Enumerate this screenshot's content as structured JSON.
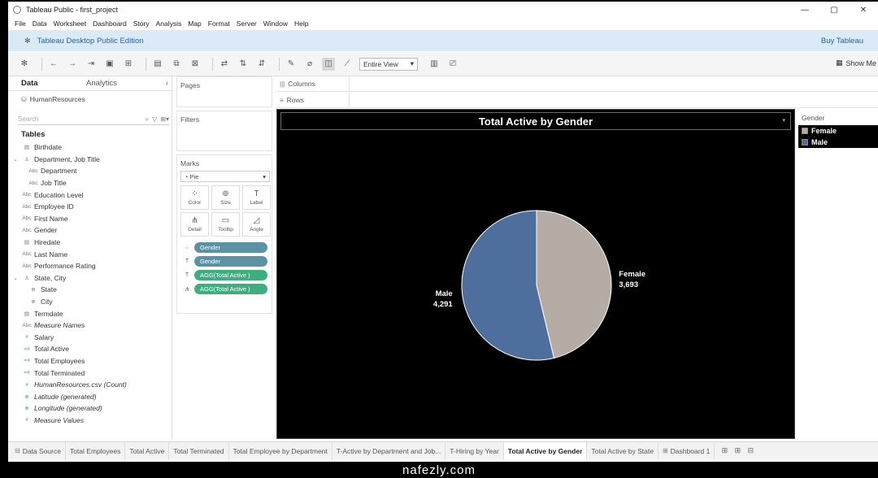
{
  "window": {
    "title": "Tableau Public - first_project",
    "controls": [
      "—",
      "▢",
      "✕"
    ]
  },
  "menu": [
    "File",
    "Data",
    "Worksheet",
    "Dashboard",
    "Story",
    "Analysis",
    "Map",
    "Format",
    "Server",
    "Window",
    "Help"
  ],
  "banner": {
    "edition": "Tableau Desktop Public Edition",
    "buy": "Buy Tableau"
  },
  "toolbar": {
    "view_mode": "Entire View",
    "show_me": "Show Me"
  },
  "data_pane": {
    "tabs": [
      "Data",
      "Analytics"
    ],
    "datasource": "HumanResources",
    "search_placeholder": "Search",
    "tables_heading": "Tables",
    "fields": [
      {
        "name": "Birthdate",
        "icon": "▤",
        "level": 0
      },
      {
        "name": "Department, Job Title",
        "icon": "♙",
        "level": 0,
        "expander": "⌄"
      },
      {
        "name": "Department",
        "icon": "Abc",
        "level": 1
      },
      {
        "name": "Job Title",
        "icon": "Abc",
        "level": 1
      },
      {
        "name": "Education Level",
        "icon": "Abc",
        "level": 0
      },
      {
        "name": "Employee ID",
        "icon": "Abc",
        "level": 0
      },
      {
        "name": "First Name",
        "icon": "Abc",
        "level": 0
      },
      {
        "name": "Gender",
        "icon": "Abc",
        "level": 0
      },
      {
        "name": "Hiredate",
        "icon": "▤",
        "level": 0
      },
      {
        "name": "Last Name",
        "icon": "Abc",
        "level": 0
      },
      {
        "name": "Performance Rating",
        "icon": "Abc",
        "level": 0
      },
      {
        "name": "State, City",
        "icon": "♙",
        "level": 0,
        "expander": "⌄"
      },
      {
        "name": "State",
        "icon": "⊕",
        "level": 1
      },
      {
        "name": "City",
        "icon": "⊕",
        "level": 1
      },
      {
        "name": "Termdate",
        "icon": "▤",
        "level": 0
      },
      {
        "name": "Measure Names",
        "icon": "Abc",
        "level": 0,
        "italic": true
      },
      {
        "name": "Salary",
        "icon": "#",
        "level": 0,
        "measure": true
      },
      {
        "name": "Total Active",
        "icon": "=#",
        "level": 0,
        "measure": true
      },
      {
        "name": "Total Employees",
        "icon": "=#",
        "level": 0,
        "measure": true
      },
      {
        "name": "Total Terminated",
        "icon": "=#",
        "level": 0,
        "measure": true
      },
      {
        "name": "HumanResources.csv (Count)",
        "icon": "#",
        "level": 0,
        "measure": true,
        "italic": true
      },
      {
        "name": "Latitude (generated)",
        "icon": "⊕",
        "level": 0,
        "measure": true,
        "italic": true
      },
      {
        "name": "Longitude (generated)",
        "icon": "⊕",
        "level": 0,
        "measure": true,
        "italic": true
      },
      {
        "name": "Measure Values",
        "icon": "#",
        "level": 0,
        "measure": true,
        "italic": true
      }
    ]
  },
  "cards": {
    "pages": "Pages",
    "filters": "Filters",
    "marks": "Marks",
    "mark_type": "Pie",
    "mark_buttons": [
      {
        "label": "Color",
        "icon": "⁘"
      },
      {
        "label": "Size",
        "icon": "⊚"
      },
      {
        "label": "Label",
        "icon": "T"
      },
      {
        "label": "Detail",
        "icon": "⋔"
      },
      {
        "label": "Tooltip",
        "icon": "▭"
      },
      {
        "label": "Angle",
        "icon": "◿"
      }
    ],
    "pills": [
      {
        "icon": "⁘",
        "label": "Gender",
        "kind": "dim"
      },
      {
        "icon": "T",
        "label": "Gender",
        "kind": "dim"
      },
      {
        "icon": "T",
        "label": "AGG(Total Active )",
        "kind": "meas"
      },
      {
        "icon": "⋔",
        "label": "AGG(Total Active )",
        "kind": "meas"
      }
    ]
  },
  "shelves": {
    "columns": "Columns",
    "rows": "Rows"
  },
  "legend": {
    "title": "Gender",
    "items": [
      {
        "label": "Female",
        "color": "#b5aca5"
      },
      {
        "label": "Male",
        "color": "#4e6f9e"
      }
    ]
  },
  "sheet_tabs": [
    {
      "label": "Data Source",
      "icon": "⊟",
      "ds": true
    },
    {
      "label": "Total Employees"
    },
    {
      "label": "Total Active"
    },
    {
      "label": "Total Terminated"
    },
    {
      "label": "Total Employee by Department"
    },
    {
      "label": "T-Active by Department and Job..."
    },
    {
      "label": "T-Hiring by Year"
    },
    {
      "label": "Total Active by Gender",
      "current": true
    },
    {
      "label": "Total Active by State"
    },
    {
      "label": "Dashboard 1",
      "icon": "⊞"
    }
  ],
  "watermark": "nafezly.com",
  "chart_data": {
    "type": "pie",
    "title": "Total Active by Gender",
    "categories": [
      "Female",
      "Male"
    ],
    "values": [
      3693,
      4291
    ],
    "value_labels": [
      "3,693",
      "4,291"
    ],
    "colors": [
      "#b5aca5",
      "#4e6f9e"
    ],
    "legend": "right"
  }
}
